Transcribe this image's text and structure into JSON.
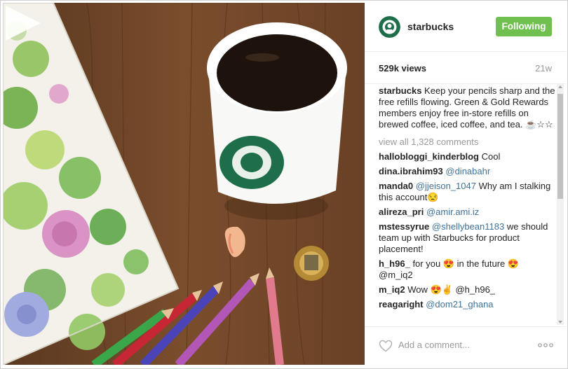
{
  "post": {
    "account": "starbucks",
    "follow_label": "Following",
    "views": "529k views",
    "age": "21w"
  },
  "caption": {
    "user": "starbucks",
    "text": "Keep your pencils sharp and the free refills flowing. Green & Gold Rewards members enjoy free in-store refills on brewed coffee, iced coffee, and tea. ☕☆☆"
  },
  "view_all": "view all 1,328 comments",
  "comments": [
    {
      "user": "hallobloggi_kinderblog",
      "mention": "",
      "text": "Cool"
    },
    {
      "user": "dina.ibrahim93",
      "mention": "@dinabahr",
      "text": ""
    },
    {
      "user": "manda0",
      "mention": "@jjeison_1047",
      "text": "Why am I stalking this account😒"
    },
    {
      "user": "alireza_pri",
      "mention": "@amir.ami.iz",
      "text": ""
    },
    {
      "user": "mstessyrue",
      "mention": "@shellybean1183",
      "text": "we should team up with Starbucks for product placement!"
    },
    {
      "user": "h_h96_",
      "mention": "",
      "text": "for you 😍 in the future 😍 @m_iq2"
    },
    {
      "user": "m_iq2",
      "mention": "",
      "text": "Wow 😍✌ @h_h96_"
    },
    {
      "user": "reagaright",
      "mention": "@dom21_ghana",
      "text": ""
    }
  ],
  "composer": {
    "placeholder": "Add a comment..."
  },
  "icons": {
    "play": "play-icon",
    "heart": "heart-icon",
    "more": "more-options-icon"
  },
  "colors": {
    "follow_green": "#70c050",
    "mention_blue": "#3f729b",
    "muted_gray": "#999999"
  }
}
